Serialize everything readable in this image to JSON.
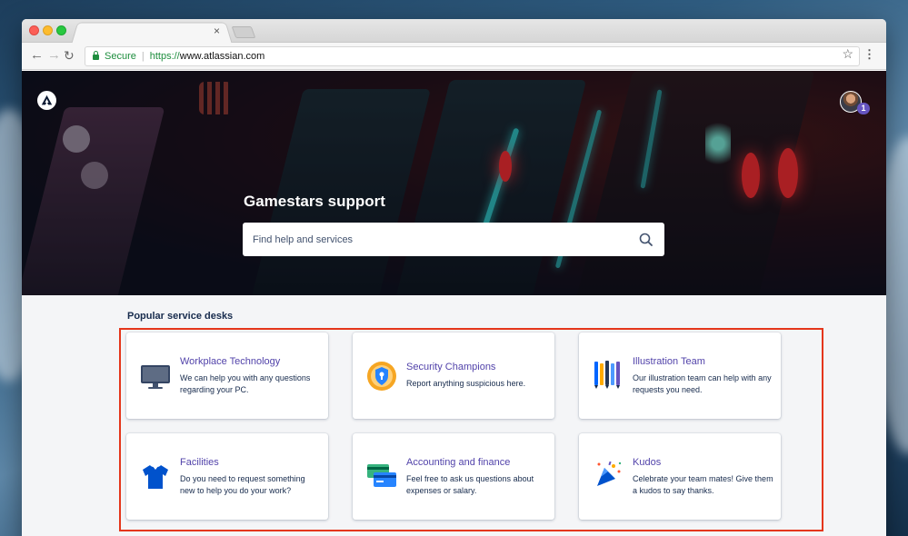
{
  "browser": {
    "security_label": "Secure",
    "url_scheme": "https://",
    "url_host": "www.atlassian.com",
    "tab_close": "×"
  },
  "hero": {
    "title": "Gamestars support",
    "search_placeholder": "Find help and services",
    "notification_count": "1"
  },
  "section": {
    "title": "Popular service desks"
  },
  "cards": [
    {
      "title": "Workplace Technology",
      "description": "We can help you with any questions regarding your PC.",
      "icon": "monitor-icon"
    },
    {
      "title": "Security Champions",
      "description": "Report anything suspicious here.",
      "icon": "security-badge-icon"
    },
    {
      "title": "Illustration Team",
      "description": "Our illustration team can help with any requests you need.",
      "icon": "pencils-icon"
    },
    {
      "title": "Facilities",
      "description": "Do you need to request something new to help you do your work?",
      "icon": "shirt-icon"
    },
    {
      "title": "Accounting and finance",
      "description": "Feel free to ask us questions about expenses or salary.",
      "icon": "credit-cards-icon"
    },
    {
      "title": "Kudos",
      "description": "Celebrate your team mates! Give them a kudos to say thanks.",
      "icon": "party-popper-icon"
    }
  ],
  "colors": {
    "link_purple": "#5243aa",
    "highlight_red": "#e4361b",
    "badge_purple": "#6554c0"
  }
}
